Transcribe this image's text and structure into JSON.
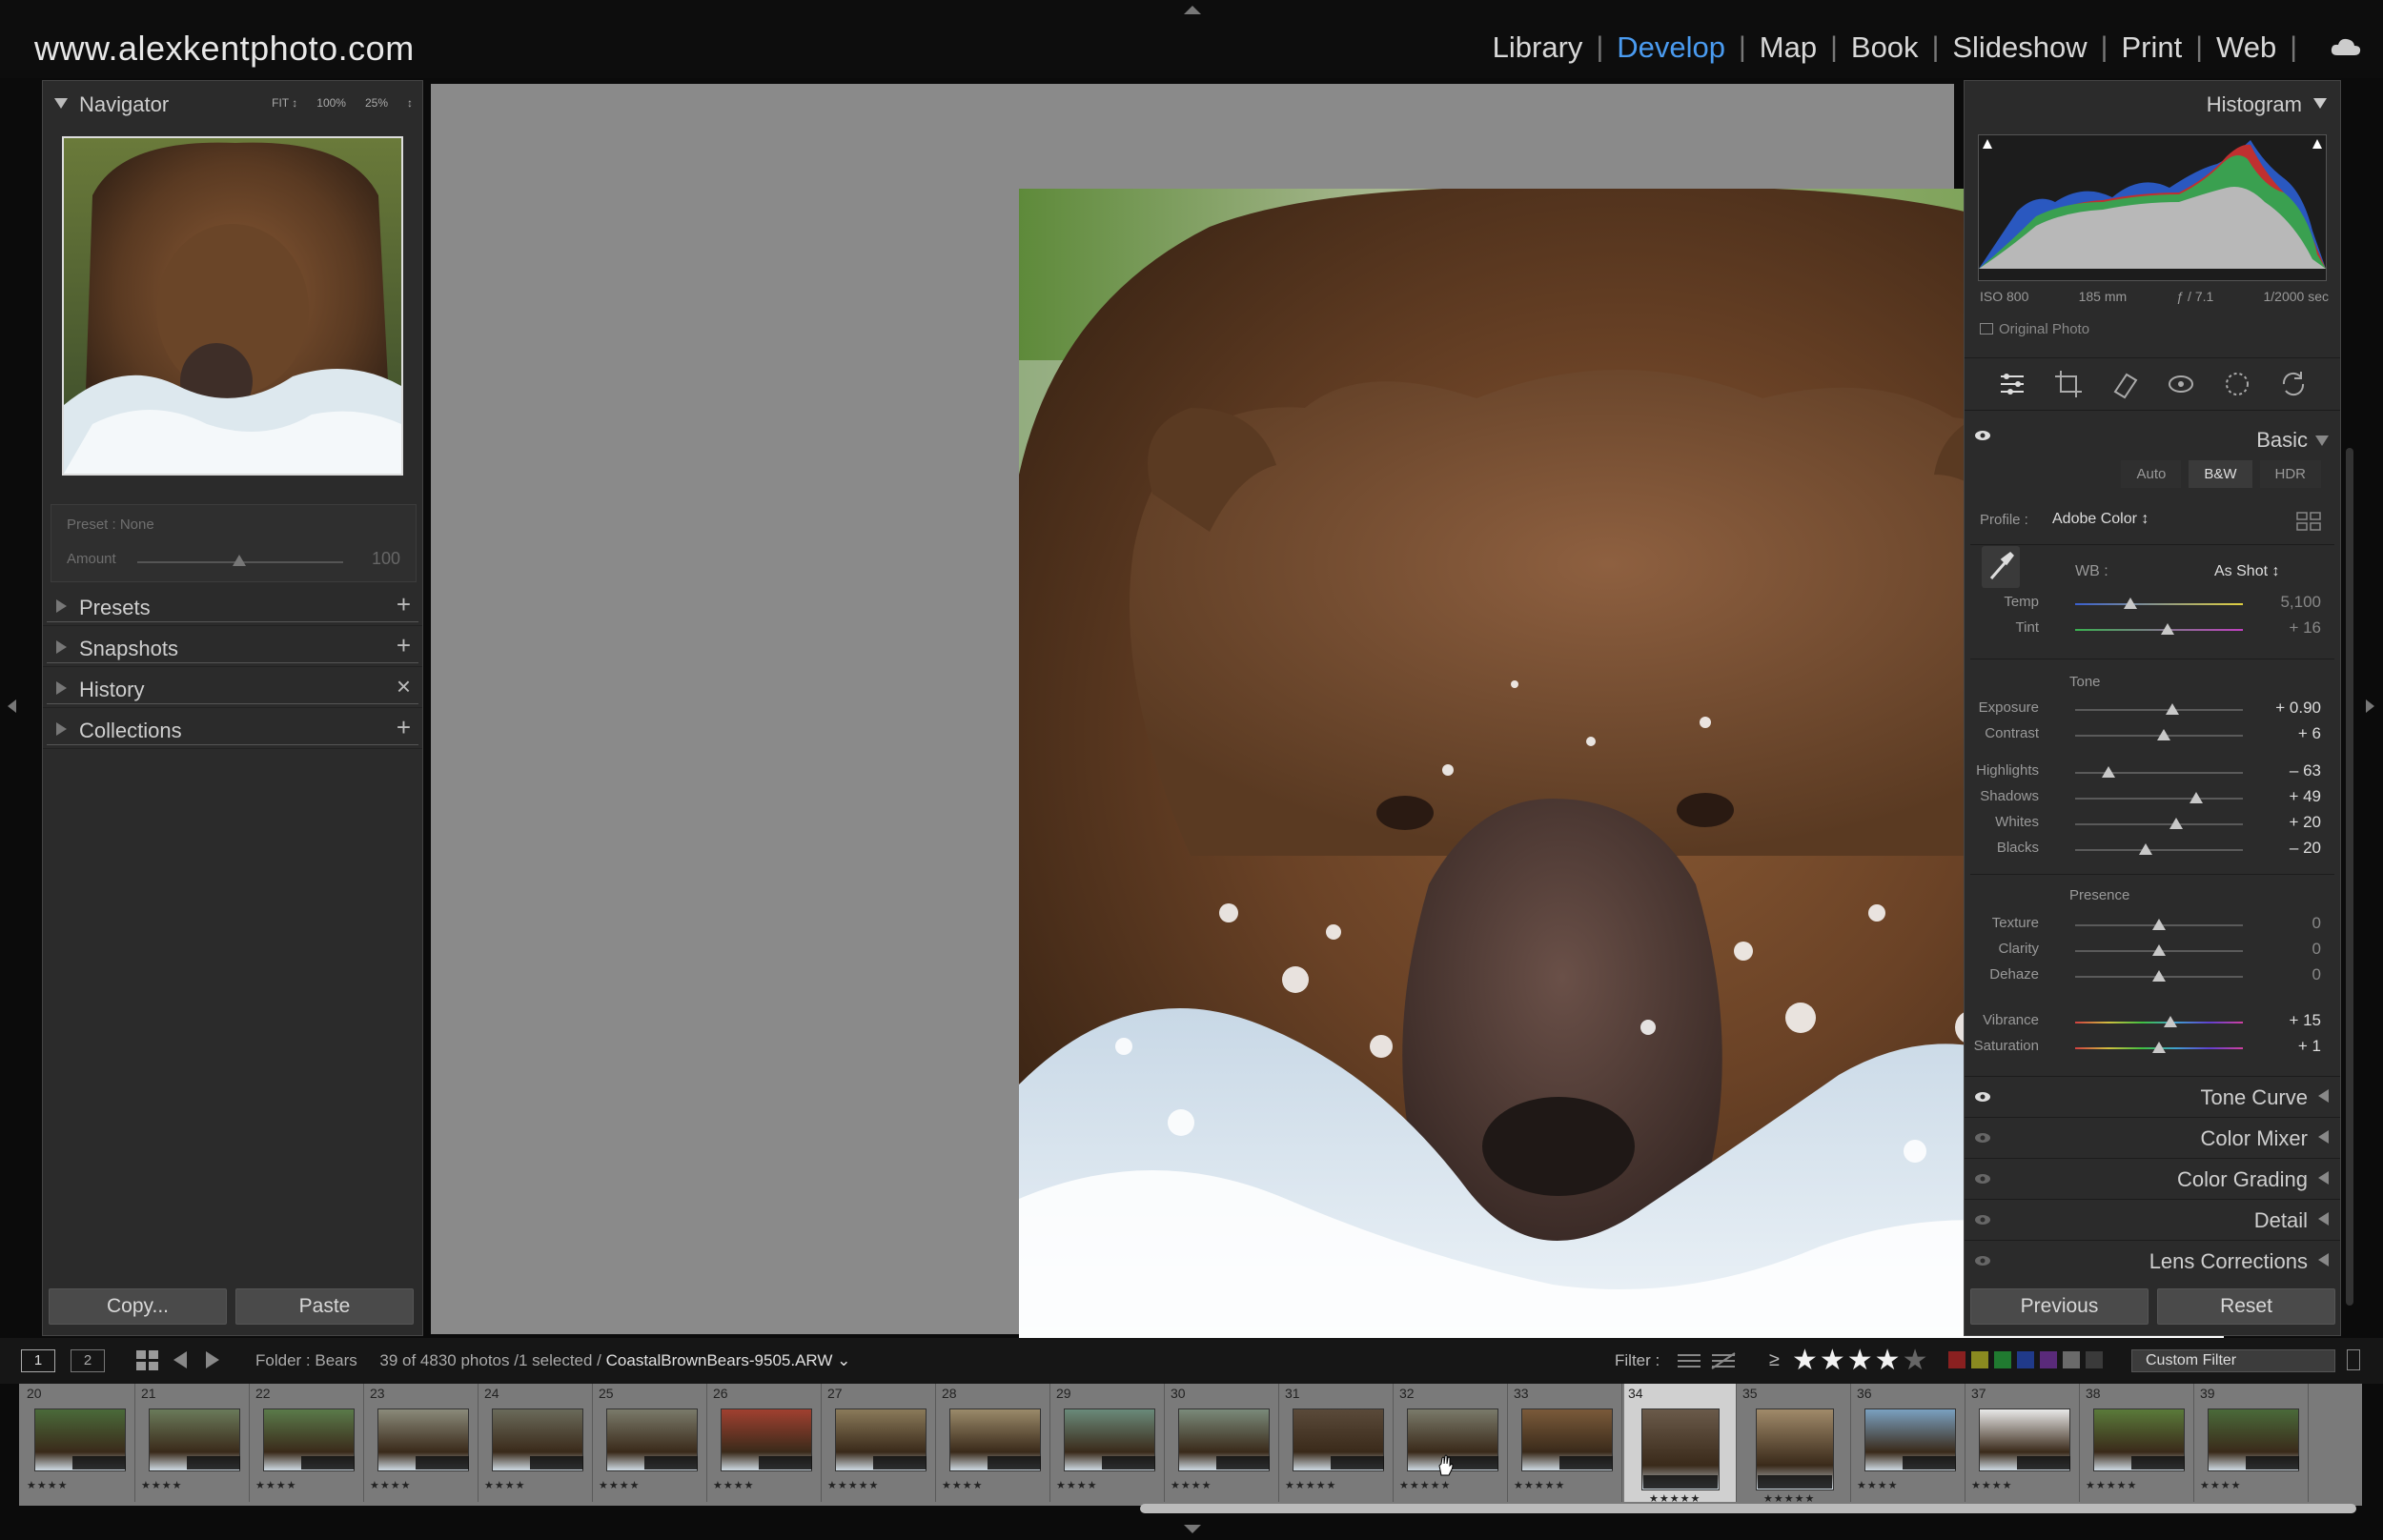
{
  "site_title": "www.alexkentphoto.com",
  "modules": [
    "Library",
    "Develop",
    "Map",
    "Book",
    "Slideshow",
    "Print",
    "Web"
  ],
  "active_module": "Develop",
  "accent_color": "#4a9bf0",
  "left": {
    "navigator_title": "Navigator",
    "zoom_options": [
      "FIT ↕",
      "100%",
      "25%",
      "↕"
    ],
    "preset_label": "Preset : None",
    "amount_label": "Amount",
    "amount_value": "100",
    "sections": [
      {
        "label": "Presets",
        "action": "+"
      },
      {
        "label": "Snapshots",
        "action": "+"
      },
      {
        "label": "History",
        "action": "×"
      },
      {
        "label": "Collections",
        "action": "+"
      }
    ],
    "copy_label": "Copy...",
    "paste_label": "Paste"
  },
  "right": {
    "histogram_title": "Histogram",
    "iso": "ISO 800",
    "focal": "185 mm",
    "aperture": "ƒ / 7.1",
    "shutter": "1/2000 sec",
    "original_photo": "Original Photo",
    "basic_title": "Basic",
    "treatment": [
      "Auto",
      "B&W",
      "HDR"
    ],
    "profile_label": "Profile :",
    "profile_value": "Adobe Color ↕",
    "wb_label": "WB :",
    "wb_value": "As Shot ↕",
    "temp": {
      "label": "Temp",
      "value": "5,100",
      "pos": 0.33
    },
    "tint": {
      "label": "Tint",
      "value": "+ 16",
      "pos": 0.55
    },
    "tone_label": "Tone",
    "exposure": {
      "label": "Exposure",
      "value": "+ 0.90",
      "pos": 0.58
    },
    "contrast": {
      "label": "Contrast",
      "value": "+ 6",
      "pos": 0.53
    },
    "highlights": {
      "label": "Highlights",
      "value": "– 63",
      "pos": 0.2
    },
    "shadows": {
      "label": "Shadows",
      "value": "+ 49",
      "pos": 0.72
    },
    "whites": {
      "label": "Whites",
      "value": "+ 20",
      "pos": 0.6
    },
    "blacks": {
      "label": "Blacks",
      "value": "– 20",
      "pos": 0.42
    },
    "presence_label": "Presence",
    "texture": {
      "label": "Texture",
      "value": "0",
      "pos": 0.5
    },
    "clarity": {
      "label": "Clarity",
      "value": "0",
      "pos": 0.5
    },
    "dehaze": {
      "label": "Dehaze",
      "value": "0",
      "pos": 0.5
    },
    "vibrance": {
      "label": "Vibrance",
      "value": "+ 15",
      "pos": 0.57
    },
    "saturation": {
      "label": "Saturation",
      "value": "+ 1",
      "pos": 0.5
    },
    "sections": [
      "Tone Curve",
      "Color Mixer",
      "Color Grading",
      "Detail",
      "Lens Corrections"
    ],
    "previous_label": "Previous",
    "reset_label": "Reset"
  },
  "filmbar": {
    "screen1": "1",
    "screen2": "2",
    "folder": "Folder : Bears",
    "count": "39 of 4830 photos /1 selected /",
    "filename": "CoastalBrownBears-9505.ARW ⌄",
    "filter_label": "Filter :",
    "ge": "≥",
    "stars_on": "★★★★",
    "stars_off": "★",
    "swatch_colors": [
      "#8a2020",
      "#8a8a20",
      "#207a30",
      "#203a8a",
      "#5a2a7a",
      "#6a6a6a",
      "#3a3a3a"
    ],
    "custom_filter": "Custom Filter"
  },
  "filmstrip": [
    {
      "num": "20",
      "stars": "★★★★"
    },
    {
      "num": "21",
      "stars": "★★★★"
    },
    {
      "num": "22",
      "stars": "★★★★"
    },
    {
      "num": "23",
      "stars": "★★★★"
    },
    {
      "num": "24",
      "stars": "★★★★"
    },
    {
      "num": "25",
      "stars": "★★★★"
    },
    {
      "num": "26",
      "stars": "★★★★"
    },
    {
      "num": "27",
      "stars": "★★★★★"
    },
    {
      "num": "28",
      "stars": "★★★★"
    },
    {
      "num": "29",
      "stars": "★★★★"
    },
    {
      "num": "30",
      "stars": "★★★★"
    },
    {
      "num": "31",
      "stars": "★★★★★"
    },
    {
      "num": "32",
      "stars": "★★★★★"
    },
    {
      "num": "33",
      "stars": "★★★★★"
    },
    {
      "num": "34",
      "stars": "★★★★★"
    },
    {
      "num": "35",
      "stars": "★★★★★"
    },
    {
      "num": "36",
      "stars": "★★★★"
    },
    {
      "num": "37",
      "stars": "★★★★"
    },
    {
      "num": "38",
      "stars": "★★★★★"
    },
    {
      "num": "39",
      "stars": "★★★★"
    }
  ]
}
